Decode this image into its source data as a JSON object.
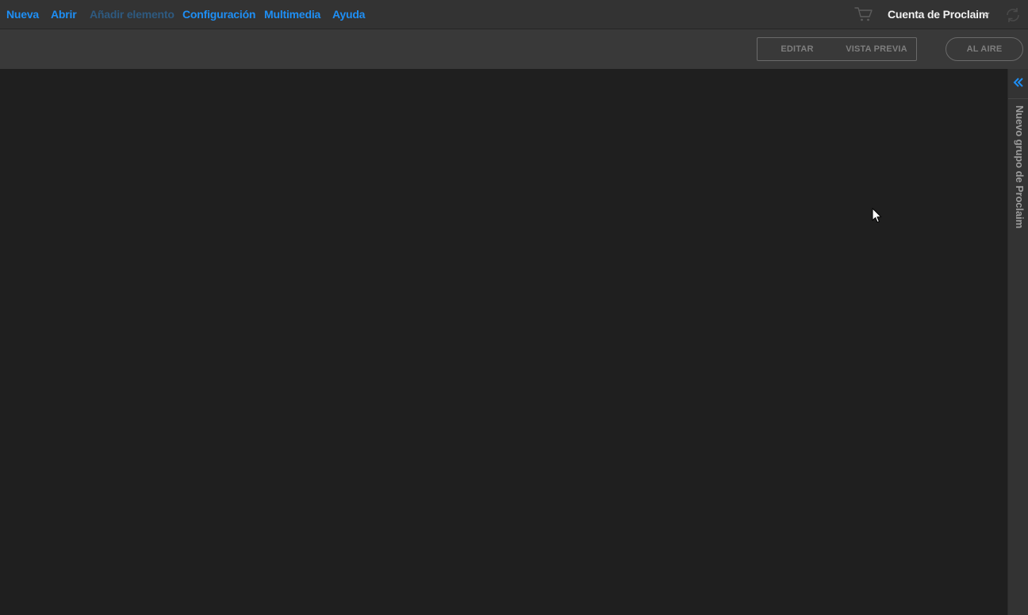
{
  "menu": {
    "items": [
      {
        "label": "Nueva",
        "enabled": true
      },
      {
        "label": "Abrir",
        "enabled": true
      },
      {
        "label": "Añadir elemento",
        "enabled": false
      },
      {
        "label": "Configuración",
        "enabled": true
      },
      {
        "label": "Multimedia",
        "enabled": true
      },
      {
        "label": "Ayuda",
        "enabled": true
      }
    ],
    "cart_icon": "shopping-cart-icon",
    "account_label": "Cuenta de Proclaim",
    "account_chevron_icon": "chevron-down-icon",
    "sync_icon": "sync-icon"
  },
  "toolbar": {
    "edit_label": "EDITAR",
    "preview_label": "VISTA PREVIA",
    "onair_label": "AL AIRE"
  },
  "side_panel": {
    "collapse_icon": "double-chevron-left-icon",
    "title": "Nuevo grupo de Proclaim"
  },
  "colors": {
    "accent": "#1e8ff5",
    "accent_disabled": "#2e5a80",
    "menubar_bg": "#333333",
    "toolbar_bg": "#393939",
    "workspace_bg": "#1f1f1f",
    "button_text": "#7e7e7e"
  }
}
